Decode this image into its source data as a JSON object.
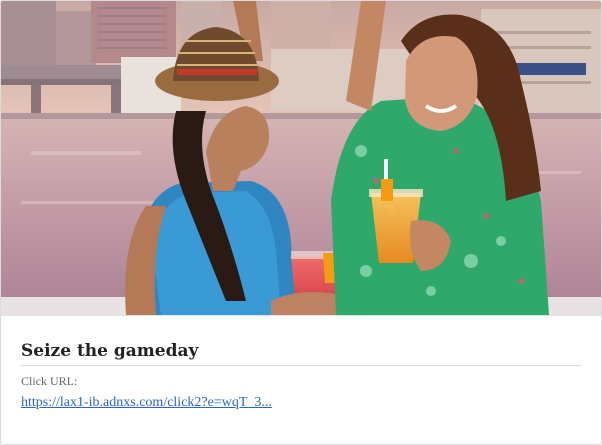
{
  "ad": {
    "title": "Seize the gameday",
    "click_label": "Click URL:",
    "click_url": "https://lax1-ib.adnxs.com/click2?e=wqT_3..."
  },
  "image": {
    "icon": "photo-two-women-toasting-waterfront"
  }
}
